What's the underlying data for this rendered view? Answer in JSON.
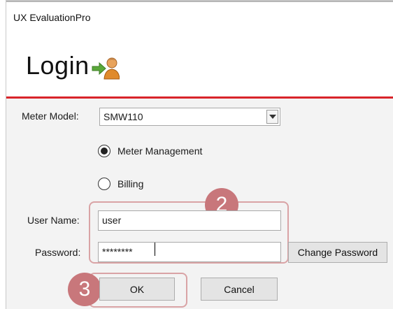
{
  "window": {
    "title": "UX EvaluationPro"
  },
  "header": {
    "heading": "Login",
    "icon": "login-user-icon"
  },
  "form": {
    "meter_model_label": "Meter Model:",
    "meter_model_value": "SMW110",
    "radios": [
      {
        "label": "Meter Management",
        "checked": true
      },
      {
        "label": "Billing",
        "checked": false
      }
    ],
    "username_label": "User Name:",
    "username_value": "user",
    "password_label": "Password:",
    "password_value": "********",
    "change_password_label": "Change Password"
  },
  "buttons": {
    "ok": "OK",
    "cancel": "Cancel"
  },
  "annotations": {
    "callout_2": "2",
    "callout_3": "3"
  },
  "colors": {
    "accent_line": "#d8242a",
    "callout": "#c8777b"
  }
}
